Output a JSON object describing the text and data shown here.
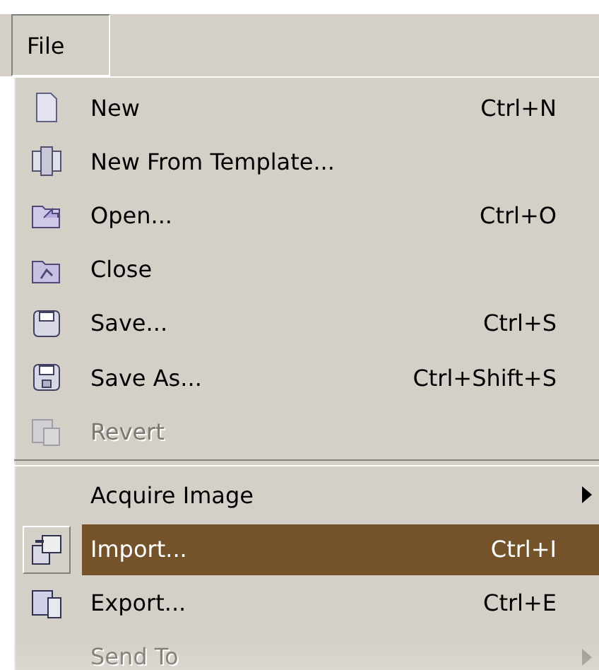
{
  "menu_bar": {
    "items": [
      {
        "label": "File",
        "selected": true
      }
    ]
  },
  "menu": {
    "items": [
      {
        "kind": "command",
        "label": "New",
        "shortcut": "Ctrl+N",
        "disabled": false,
        "selected": false
      },
      {
        "kind": "command",
        "label": "New From Template...",
        "disabled": false,
        "selected": false
      },
      {
        "kind": "command",
        "label": "Open...",
        "shortcut": "Ctrl+O",
        "disabled": false,
        "selected": false
      },
      {
        "kind": "command",
        "label": "Close",
        "disabled": false,
        "selected": false
      },
      {
        "kind": "command",
        "label": "Save...",
        "shortcut": "Ctrl+S",
        "disabled": false,
        "selected": false
      },
      {
        "kind": "command",
        "label": "Save As...",
        "shortcut": "Ctrl+Shift+S",
        "disabled": false,
        "selected": false
      },
      {
        "kind": "command",
        "label": "Revert",
        "disabled": true,
        "selected": false
      },
      {
        "kind": "separator"
      },
      {
        "kind": "submenu",
        "label": "Acquire Image",
        "disabled": false,
        "selected": false
      },
      {
        "kind": "command",
        "label": "Import...",
        "shortcut": "Ctrl+I",
        "disabled": false,
        "selected": true
      },
      {
        "kind": "command",
        "label": "Export...",
        "shortcut": "Ctrl+E",
        "disabled": false,
        "selected": false
      },
      {
        "kind": "submenu",
        "label": "Send To",
        "disabled": true,
        "selected": false
      }
    ]
  }
}
